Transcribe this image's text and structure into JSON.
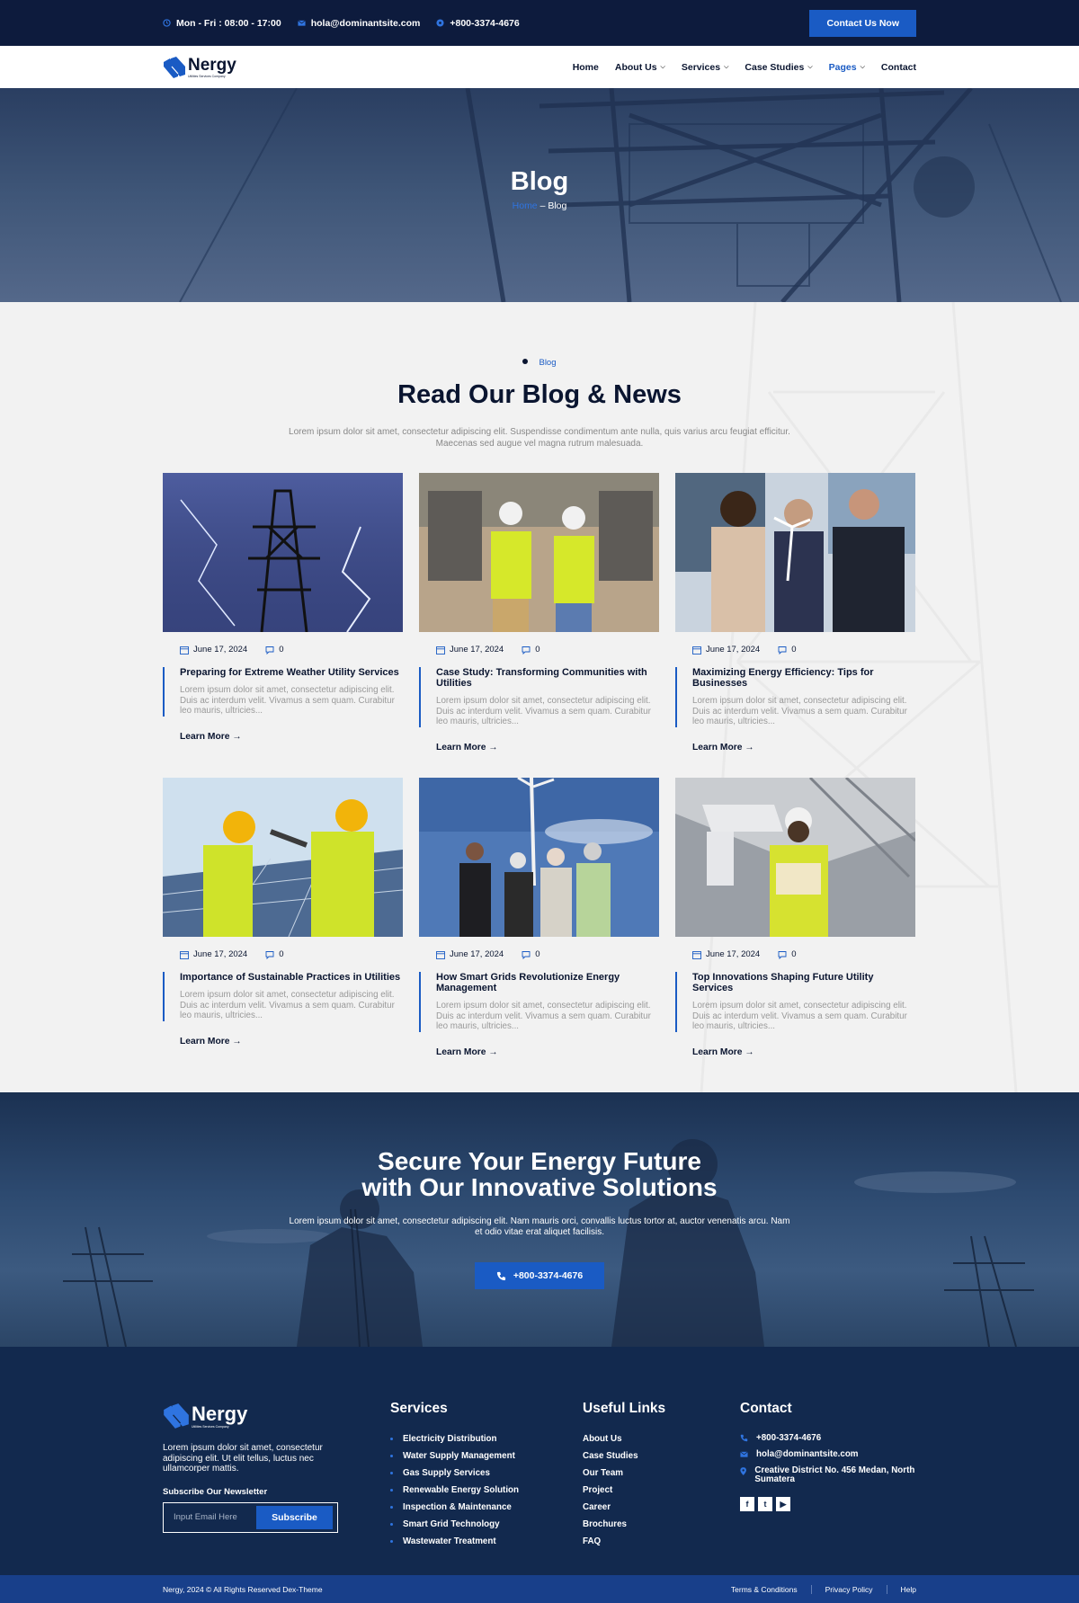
{
  "topbar": {
    "hours": "Mon - Fri : 08:00 - 17:00",
    "email": "hola@dominantsite.com",
    "phone": "+800-3374-4676",
    "cta": "Contact Us Now"
  },
  "brand": {
    "name": "Nergy",
    "tagline": "Utilities Services Company"
  },
  "nav": [
    {
      "label": "Home",
      "dropdown": false,
      "active": false
    },
    {
      "label": "About Us",
      "dropdown": true,
      "active": false
    },
    {
      "label": "Services",
      "dropdown": true,
      "active": false
    },
    {
      "label": "Case Studies",
      "dropdown": true,
      "active": false
    },
    {
      "label": "Pages",
      "dropdown": true,
      "active": true
    },
    {
      "label": "Contact",
      "dropdown": false,
      "active": false
    }
  ],
  "hero": {
    "title": "Blog",
    "breadcrumb_home": "Home",
    "breadcrumb_sep": "–",
    "breadcrumb_current": "Blog"
  },
  "section": {
    "eyebrow": "Blog",
    "title": "Read Our Blog & News",
    "description": "Lorem ipsum dolor sit amet, consectetur adipiscing elit. Suspendisse condimentum ante nulla, quis varius arcu feugiat efficitur. Maecenas sed augue vel magna rutrum malesuada."
  },
  "posts": [
    {
      "date": "June 17, 2024",
      "comments": "0",
      "title": "Preparing for Extreme Weather Utility Services",
      "excerpt": "Lorem ipsum dolor sit amet, consectetur adipiscing elit. Duis ac interdum velit. Vivamus a sem quam. Curabitur leo mauris, ultricies...",
      "link": "Learn More"
    },
    {
      "date": "June 17, 2024",
      "comments": "0",
      "title": "Case Study: Transforming Communities with Utilities",
      "excerpt": "Lorem ipsum dolor sit amet, consectetur adipiscing elit. Duis ac interdum velit. Vivamus a sem quam. Curabitur leo mauris, ultricies...",
      "link": "Learn More"
    },
    {
      "date": "June 17, 2024",
      "comments": "0",
      "title": "Maximizing Energy Efficiency: Tips for Businesses",
      "excerpt": "Lorem ipsum dolor sit amet, consectetur adipiscing elit. Duis ac interdum velit. Vivamus a sem quam. Curabitur leo mauris, ultricies...",
      "link": "Learn More"
    },
    {
      "date": "June 17, 2024",
      "comments": "0",
      "title": "Importance of Sustainable Practices in Utilities",
      "excerpt": "Lorem ipsum dolor sit amet, consectetur adipiscing elit. Duis ac interdum velit. Vivamus a sem quam. Curabitur leo mauris, ultricies...",
      "link": "Learn More"
    },
    {
      "date": "June 17, 2024",
      "comments": "0",
      "title": "How Smart Grids Revolutionize Energy Management",
      "excerpt": "Lorem ipsum dolor sit amet, consectetur adipiscing elit. Duis ac interdum velit. Vivamus a sem quam. Curabitur leo mauris, ultricies...",
      "link": "Learn More"
    },
    {
      "date": "June 17, 2024",
      "comments": "0",
      "title": "Top Innovations Shaping Future Utility Services",
      "excerpt": "Lorem ipsum dolor sit amet, consectetur adipiscing elit. Duis ac interdum velit. Vivamus a sem quam. Curabitur leo mauris, ultricies...",
      "link": "Learn More"
    }
  ],
  "cta": {
    "title_line1": "Secure Your Energy Future",
    "title_line2": "with Our Innovative Solutions",
    "description": "Lorem ipsum dolor sit amet, consectetur adipiscing elit. Nam mauris orci, convallis luctus tortor at, auctor venenatis arcu. Nam et odio vitae erat aliquet facilisis.",
    "phone": "+800-3374-4676"
  },
  "footer": {
    "about": "Lorem ipsum dolor sit amet, consectetur adipiscing elit. Ut elit tellus, luctus nec ullamcorper mattis.",
    "newsletter_label": "Subscribe Our Newsletter",
    "email_placeholder": "Input Email Here",
    "subscribe": "Subscribe",
    "services_title": "Services",
    "services": [
      "Electricity Distribution",
      "Water Supply Management",
      "Gas Supply Services",
      "Renewable Energy Solution",
      "Inspection & Maintenance",
      "Smart Grid Technology",
      "Wastewater Treatment"
    ],
    "links_title": "Useful Links",
    "links": [
      "About Us",
      "Case Studies",
      "Our Team",
      "Project",
      "Career",
      "Brochures",
      "FAQ"
    ],
    "contact_title": "Contact",
    "phone": "+800-3374-4676",
    "email": "hola@dominantsite.com",
    "address": "Creative District No. 456 Medan, North Sumatera",
    "social": [
      "f",
      "t",
      "▶"
    ]
  },
  "bottom": {
    "copyright": "Nergy, 2024 © All Rights Reserved Dex-Theme",
    "links": [
      "Terms & Conditions",
      "Privacy Policy",
      "Help"
    ]
  },
  "colors": {
    "navy": "#0d1b3d",
    "accent": "#1a5bc4",
    "footer": "#12294e",
    "bottom": "#183f8a"
  }
}
